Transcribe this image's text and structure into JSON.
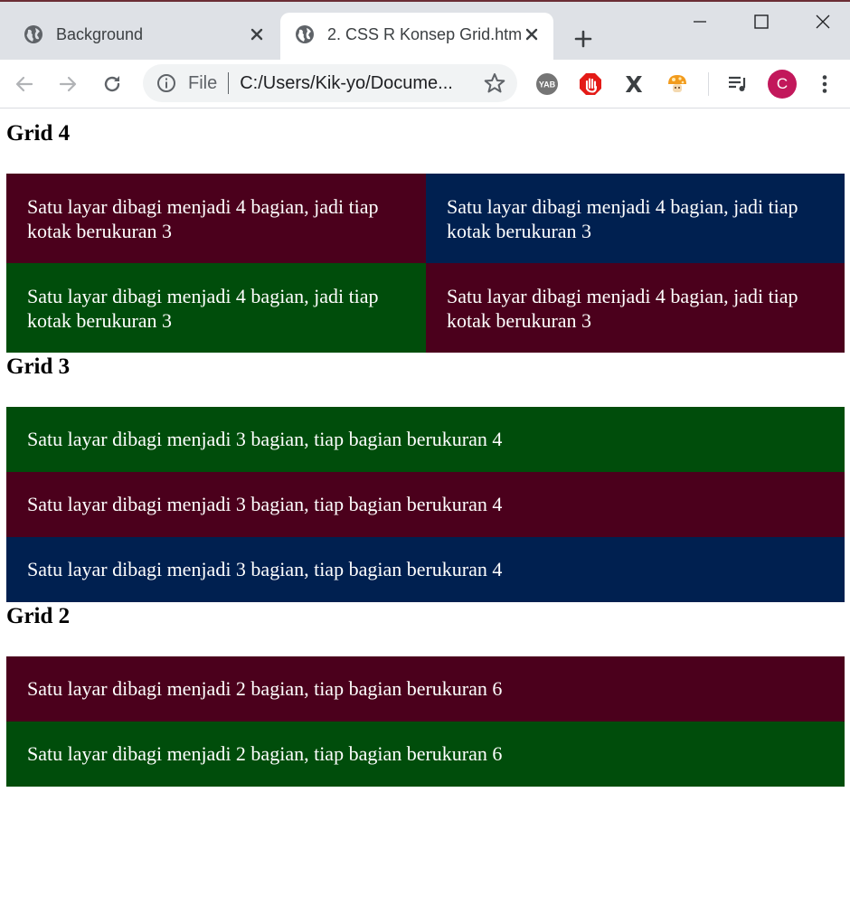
{
  "browser": {
    "tabs": [
      {
        "title": "Background",
        "active": false
      },
      {
        "title": "2. CSS R Konsep Grid.html",
        "active": true
      }
    ],
    "address": {
      "scheme": "File",
      "url": "C:/Users/Kik-yo/Docume..."
    },
    "extensions": [
      "YAB",
      "stop-hand",
      "X",
      "mushroom"
    ],
    "profile_initial": "C",
    "icons": [
      "globe-icon",
      "close-icon",
      "plus-icon",
      "back-icon",
      "forward-icon",
      "reload-icon",
      "info-icon",
      "star-icon",
      "media-control-icon",
      "more-vert-icon",
      "minimize-icon",
      "maximize-icon",
      "window-close-icon"
    ]
  },
  "colors": {
    "maroon": "#4b001c",
    "navy": "#002050",
    "green": "#004d0b",
    "chrome_bg": "#dee1e6",
    "avatar": "#c2185b"
  },
  "sections": {
    "grid4": {
      "heading": "Grid 4",
      "cells": [
        "Satu layar dibagi menjadi 4 bagian, jadi tiap kotak berukuran 3",
        "Satu layar dibagi menjadi 4 bagian, jadi tiap kotak berukuran 3",
        "Satu layar dibagi menjadi 4 bagian, jadi tiap kotak berukuran 3",
        "Satu layar dibagi menjadi 4 bagian, jadi tiap kotak berukuran 3"
      ]
    },
    "grid3": {
      "heading": "Grid 3",
      "cells": [
        "Satu layar dibagi menjadi 3 bagian, tiap bagian berukuran 4",
        "Satu layar dibagi menjadi 3 bagian, tiap bagian berukuran 4",
        "Satu layar dibagi menjadi 3 bagian, tiap bagian berukuran 4"
      ]
    },
    "grid2": {
      "heading": "Grid 2",
      "cells": [
        "Satu layar dibagi menjadi 2 bagian, tiap bagian berukuran 6",
        "Satu layar dibagi menjadi 2 bagian, tiap bagian berukuran 6"
      ]
    }
  }
}
